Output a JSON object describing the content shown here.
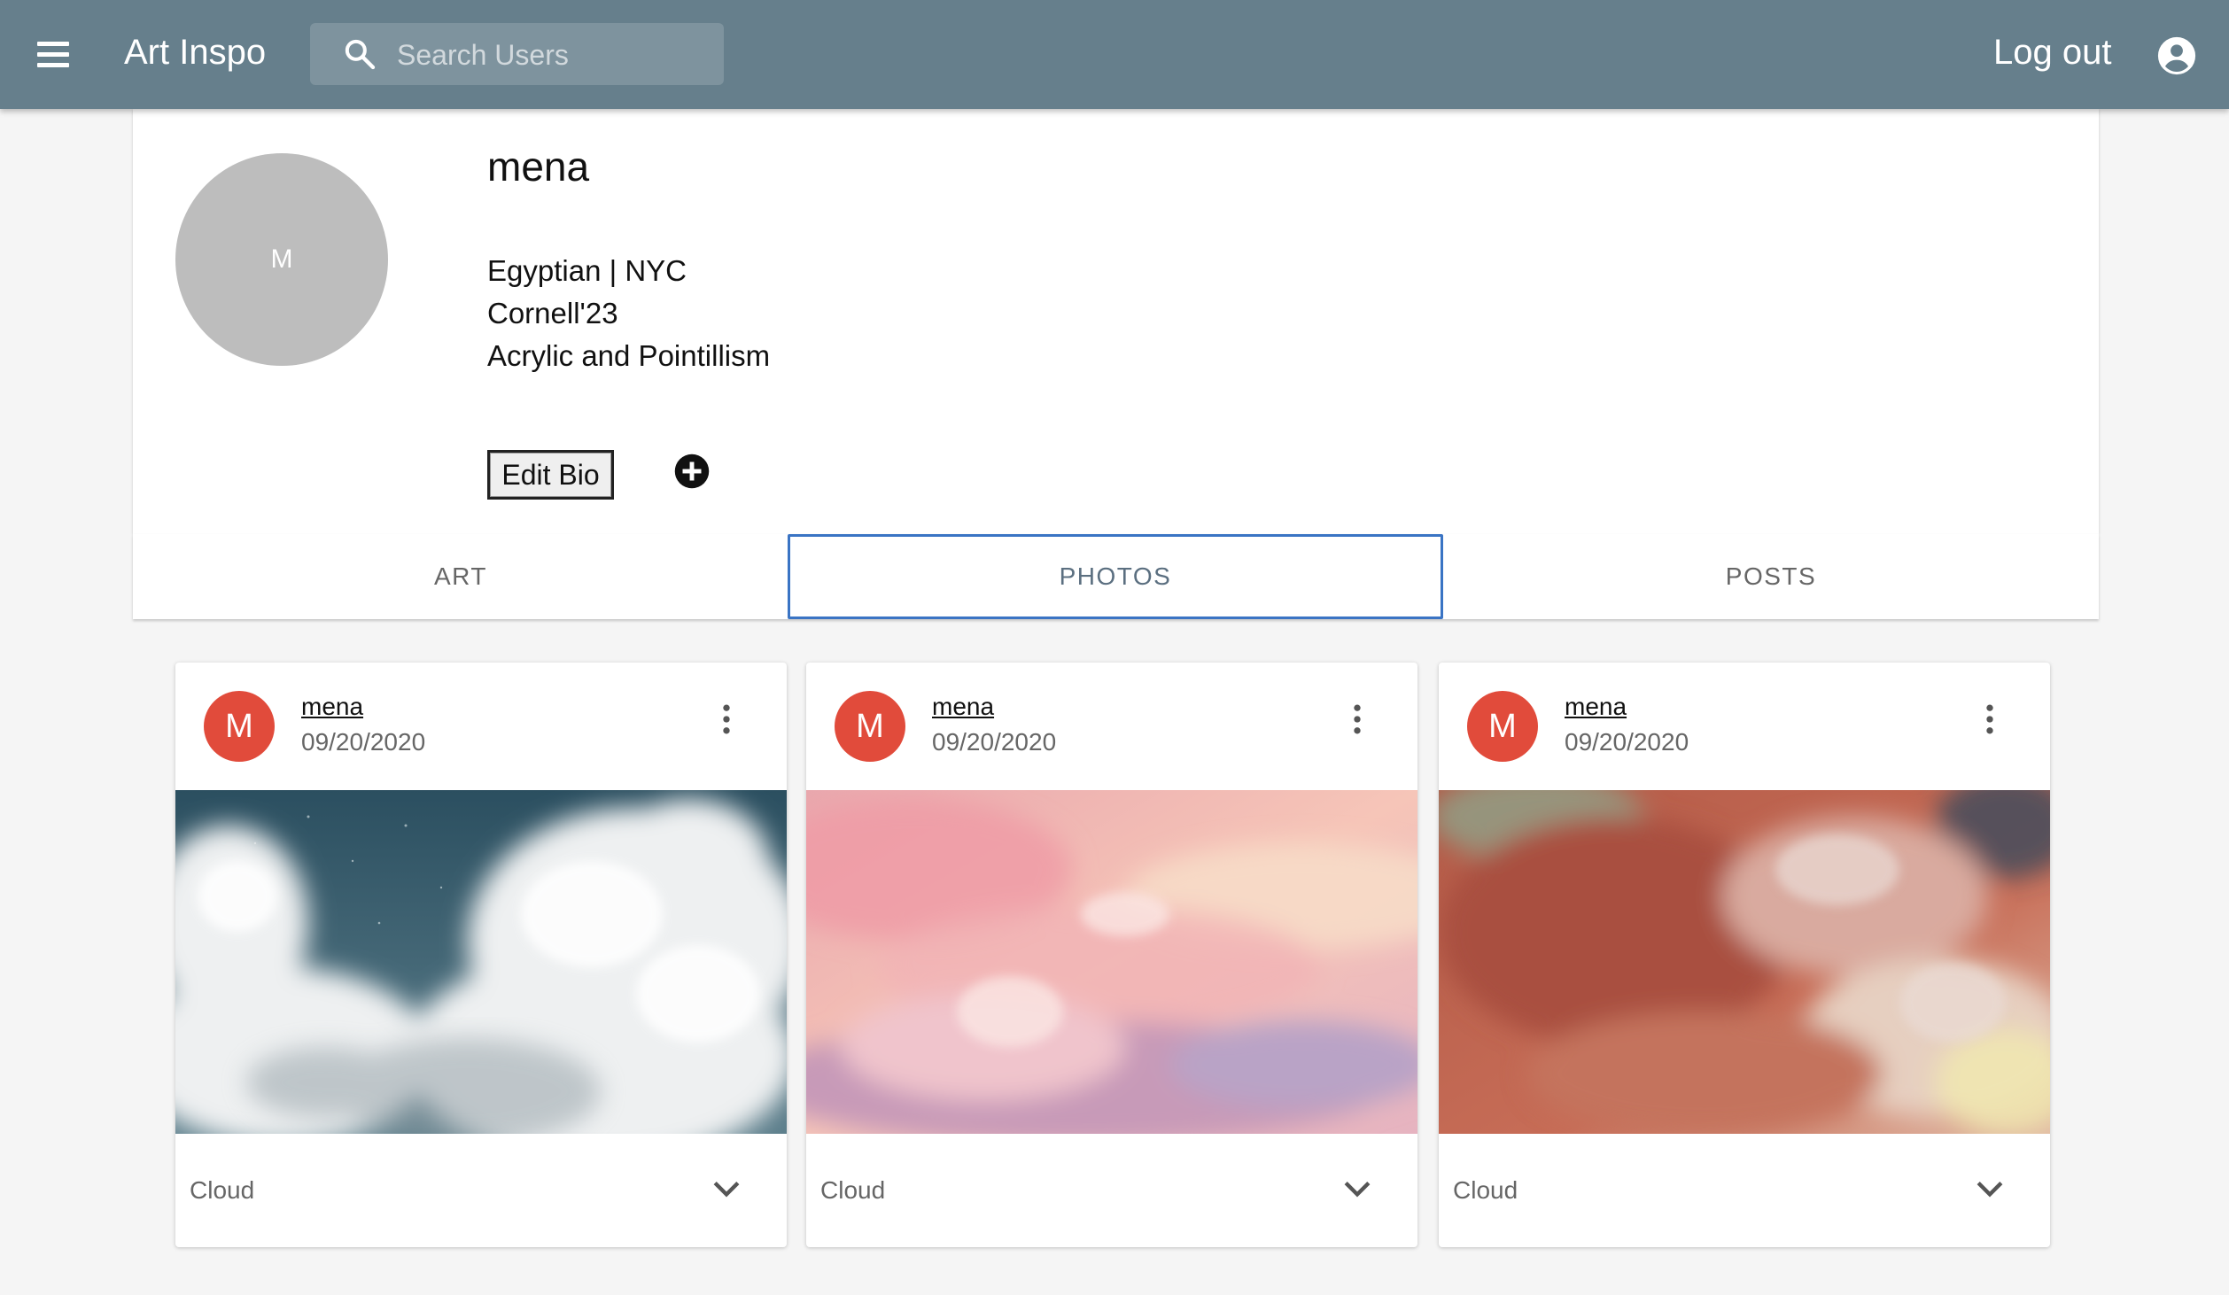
{
  "appbar": {
    "title": "Art Inspo",
    "search_placeholder": "Search Users",
    "logout_label": "Log out",
    "color": "#667f8c"
  },
  "profile": {
    "avatar_letter": "M",
    "name": "mena",
    "bio": [
      "Egyptian | NYC",
      "Cornell'23",
      "Acrylic and Pointillism"
    ],
    "edit_bio_label": "Edit Bio"
  },
  "tabs": [
    {
      "label": "ART",
      "active": false
    },
    {
      "label": "PHOTOS",
      "active": true
    },
    {
      "label": "POSTS",
      "active": false
    }
  ],
  "cards": [
    {
      "avatar_letter": "M",
      "user": "mena",
      "date": "09/20/2020",
      "caption": "Cloud",
      "image": "blue-sky-clouds"
    },
    {
      "avatar_letter": "M",
      "user": "mena",
      "date": "09/20/2020",
      "caption": "Cloud",
      "image": "pink-sunset-clouds"
    },
    {
      "avatar_letter": "M",
      "user": "mena",
      "date": "09/20/2020",
      "caption": "Cloud",
      "image": "red-smoky-clouds"
    }
  ],
  "colors": {
    "avatar_red": "#e14b3b",
    "active_tab_border": "#3a74c4"
  }
}
